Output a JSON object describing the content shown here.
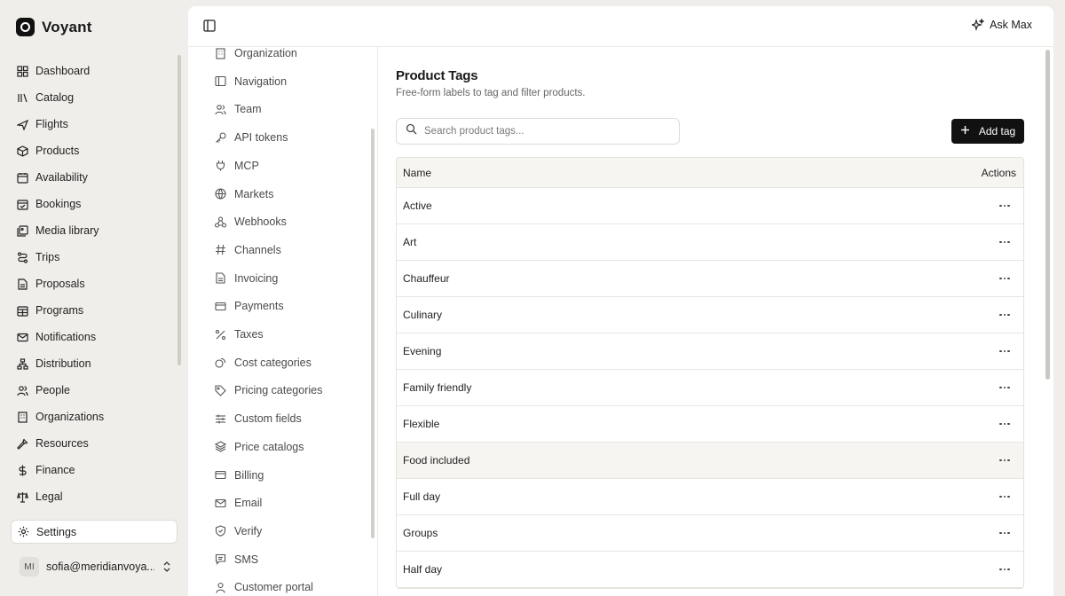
{
  "brand": {
    "name": "Voyant"
  },
  "sidebar": {
    "items": [
      {
        "label": "Dashboard",
        "icon": "dashboard-icon"
      },
      {
        "label": "Catalog",
        "icon": "catalog-icon"
      },
      {
        "label": "Flights",
        "icon": "plane-icon"
      },
      {
        "label": "Products",
        "icon": "box-icon"
      },
      {
        "label": "Availability",
        "icon": "calendar-icon"
      },
      {
        "label": "Bookings",
        "icon": "calendar-check-icon"
      },
      {
        "label": "Media library",
        "icon": "image-icon"
      },
      {
        "label": "Trips",
        "icon": "route-icon"
      },
      {
        "label": "Proposals",
        "icon": "document-icon"
      },
      {
        "label": "Programs",
        "icon": "calendar-grid-icon"
      },
      {
        "label": "Notifications",
        "icon": "mail-icon"
      },
      {
        "label": "Distribution",
        "icon": "network-icon"
      },
      {
        "label": "People",
        "icon": "people-icon"
      },
      {
        "label": "Organizations",
        "icon": "building-icon"
      },
      {
        "label": "Resources",
        "icon": "wrench-icon"
      },
      {
        "label": "Finance",
        "icon": "dollar-icon"
      },
      {
        "label": "Legal",
        "icon": "scale-icon"
      }
    ],
    "active": {
      "label": "Settings",
      "icon": "gear-icon"
    }
  },
  "user": {
    "initials": "MI",
    "email": "sofia@meridianvoya..."
  },
  "topbar": {
    "ask_label": "Ask Max"
  },
  "settings_nav": [
    {
      "label": "Organization",
      "icon": "building-icon"
    },
    {
      "label": "Navigation",
      "icon": "panel-icon"
    },
    {
      "label": "Team",
      "icon": "people-icon"
    },
    {
      "label": "API tokens",
      "icon": "key-icon"
    },
    {
      "label": "MCP",
      "icon": "plug-icon"
    },
    {
      "label": "Markets",
      "icon": "globe-icon"
    },
    {
      "label": "Webhooks",
      "icon": "webhook-icon"
    },
    {
      "label": "Channels",
      "icon": "hash-icon"
    },
    {
      "label": "Invoicing",
      "icon": "document-icon"
    },
    {
      "label": "Payments",
      "icon": "card-icon"
    },
    {
      "label": "Taxes",
      "icon": "percent-icon"
    },
    {
      "label": "Cost categories",
      "icon": "coins-icon"
    },
    {
      "label": "Pricing categories",
      "icon": "tag-icon"
    },
    {
      "label": "Custom fields",
      "icon": "sliders-icon"
    },
    {
      "label": "Price catalogs",
      "icon": "layers-icon"
    },
    {
      "label": "Billing",
      "icon": "card-icon"
    },
    {
      "label": "Email",
      "icon": "mail-icon"
    },
    {
      "label": "Verify",
      "icon": "shield-icon"
    },
    {
      "label": "SMS",
      "icon": "message-icon"
    },
    {
      "label": "Customer portal",
      "icon": "user-icon"
    }
  ],
  "page": {
    "title": "Product Tags",
    "subtitle": "Free-form labels to tag and filter products."
  },
  "search": {
    "placeholder": "Search product tags..."
  },
  "add_button": {
    "label": "Add tag"
  },
  "table": {
    "columns": [
      "Name",
      "Actions"
    ],
    "rows": [
      "Active",
      "Art",
      "Chauffeur",
      "Culinary",
      "Evening",
      "Family friendly",
      "Flexible",
      "Food included",
      "Full day",
      "Groups",
      "Half day"
    ]
  }
}
